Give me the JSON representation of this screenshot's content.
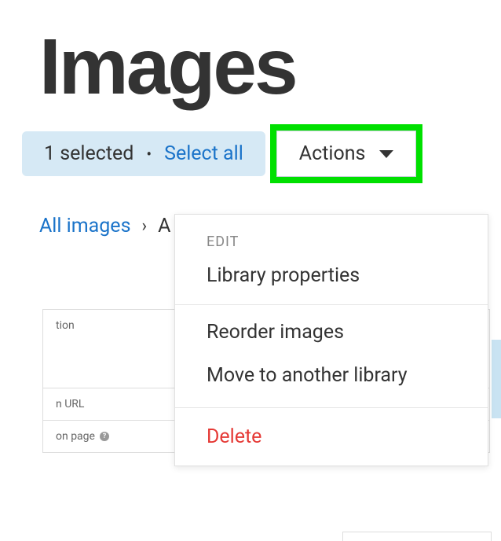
{
  "page": {
    "title": "Images"
  },
  "toolbar": {
    "selected_count": "1 selected",
    "bullet": "•",
    "select_all": "Select all",
    "actions_label": "Actions"
  },
  "breadcrumb": {
    "root": "All images",
    "separator": "›",
    "truncated": "A"
  },
  "menu": {
    "edit_header": "EDIT",
    "library_properties": "Library properties",
    "reorder_images": "Reorder images",
    "move_library": "Move to another library",
    "delete": "Delete"
  },
  "panel": {
    "row1": "tion",
    "row2": "n URL",
    "row3": "on page",
    "help_glyph": "?"
  }
}
